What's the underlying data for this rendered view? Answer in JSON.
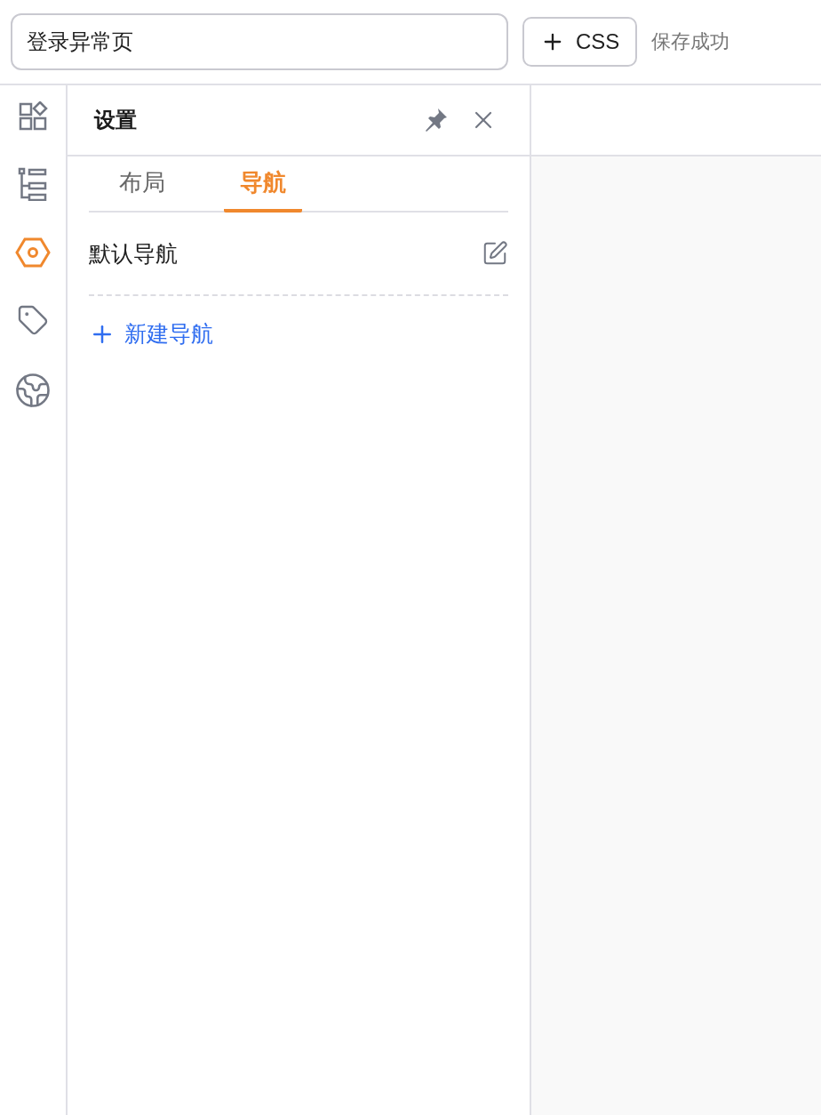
{
  "title_field": {
    "value": "登录异常页"
  },
  "css_button": {
    "label": "CSS"
  },
  "save_status": "保存成功",
  "rail": [
    {
      "kind": "components",
      "selected": false
    },
    {
      "kind": "tree",
      "selected": false
    },
    {
      "kind": "settings",
      "selected": true
    },
    {
      "kind": "tag",
      "selected": false
    },
    {
      "kind": "globe",
      "selected": false
    }
  ],
  "panel": {
    "title": "设置",
    "tabs": [
      {
        "label": "布局",
        "selected": false
      },
      {
        "label": "导航",
        "selected": true
      }
    ],
    "navigations": [
      {
        "label": "默认导航"
      }
    ],
    "add_button": {
      "label": "新建导航"
    }
  }
}
